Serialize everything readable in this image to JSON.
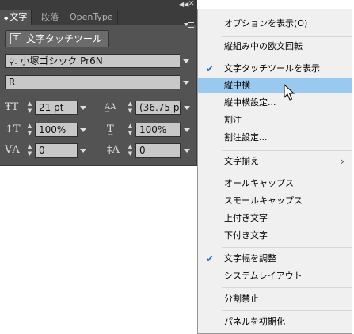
{
  "panel": {
    "tabs": [
      "文字",
      "段落",
      "OpenType"
    ],
    "touch_tool_button": "文字タッチツール",
    "font_family": "小塚ゴシック Pr6N",
    "font_style": "R",
    "font_size": "21 pt",
    "leading": "(36.75 p",
    "vertical_scale": "100%",
    "horizontal_scale": "100%",
    "kerning": "0",
    "tracking": "0"
  },
  "menu": {
    "items": [
      {
        "label": "オプションを表示(O)"
      },
      {
        "label": "縦組み中の欧文回転"
      },
      {
        "label": "文字タッチツールを表示",
        "checked": true
      },
      {
        "label": "縦中横",
        "highlighted": true
      },
      {
        "label": "縦中横設定..."
      },
      {
        "label": "割注"
      },
      {
        "label": "割注設定..."
      },
      {
        "label": "文字揃え",
        "submenu": true
      },
      {
        "label": "オールキャップス"
      },
      {
        "label": "スモールキャップス"
      },
      {
        "label": "上付き文字"
      },
      {
        "label": "下付き文字"
      },
      {
        "label": "文字幅を調整",
        "checked": true
      },
      {
        "label": "システムレイアウト"
      },
      {
        "label": "分割禁止"
      },
      {
        "label": "パネルを初期化"
      }
    ]
  },
  "colors": {
    "panel_bg": "#535353",
    "menu_bg": "#f0f0f0",
    "highlight": "#99c9ef",
    "check": "#2a6fb8"
  }
}
